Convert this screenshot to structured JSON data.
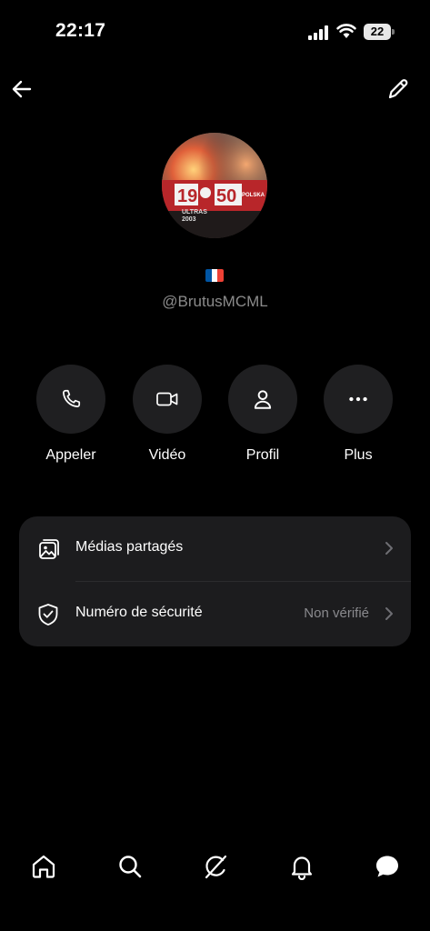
{
  "status_bar": {
    "time": "22:17",
    "battery_level": "22"
  },
  "profile": {
    "handle": "@BrutusMCML",
    "flag": "france-flag",
    "avatar_banner_text": [
      "19",
      "50",
      "ULTRAS",
      "2003",
      "POLSKA"
    ]
  },
  "actions": [
    {
      "label": "Appeler",
      "icon": "phone-icon"
    },
    {
      "label": "Vidéo",
      "icon": "video-icon"
    },
    {
      "label": "Profil",
      "icon": "person-icon"
    },
    {
      "label": "Plus",
      "icon": "more-icon"
    }
  ],
  "settings": {
    "shared_media_label": "Médias partagés",
    "security_number_label": "Numéro de sécurité",
    "security_number_value": "Non vérifié"
  },
  "nav": [
    "home-icon",
    "search-icon",
    "grok-icon",
    "bell-icon",
    "messages-icon"
  ],
  "colors": {
    "background": "#000000",
    "card": "#1c1c1e",
    "button": "#1f1f21",
    "muted_text": "#8b8b8b"
  }
}
